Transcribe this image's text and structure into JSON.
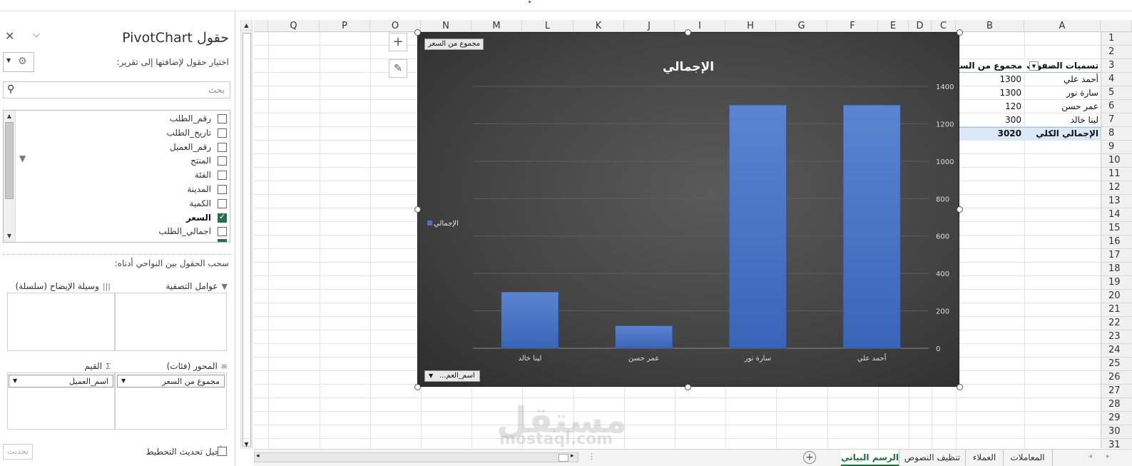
{
  "pane": {
    "title": "حقول PivotChart",
    "subtitle": "اختيار حقول لإضافتها إلى تقرير:",
    "search_placeholder": "بحث",
    "fields": [
      {
        "label": "رقم_الطلب",
        "checked": false
      },
      {
        "label": "تاريخ_الطلب",
        "checked": false
      },
      {
        "label": "رقم_العميل",
        "checked": false
      },
      {
        "label": "المنتج",
        "checked": false
      },
      {
        "label": "الفئة",
        "checked": false
      },
      {
        "label": "المدينة",
        "checked": false
      },
      {
        "label": "الكمية",
        "checked": false
      },
      {
        "label": "السعر",
        "checked": true
      },
      {
        "label": "اجمالي_الطلب",
        "checked": false
      }
    ],
    "drag_hint": "سحب الحقول بين النواحي أدناه:",
    "areas": {
      "filters": "عوامل التصفية",
      "legend": "وسيلة الإيضاح (سلسلة)",
      "axis": "المحور (فئات)",
      "values": "القيم",
      "axis_item": "اسم_العميل",
      "values_item": "مجموع من السعر"
    },
    "defer_label": "تأجيل تحديث التخطيط",
    "update_button": "تحديث"
  },
  "grid": {
    "columns": [
      "Q",
      "P",
      "O",
      "N",
      "M",
      "L",
      "K",
      "J",
      "I",
      "H",
      "G",
      "F",
      "E",
      "D",
      "C",
      "B",
      "A"
    ],
    "rows": [
      "1",
      "2",
      "3",
      "4",
      "5",
      "6",
      "7",
      "8",
      "9",
      "10",
      "11",
      "12",
      "13",
      "14",
      "15",
      "16",
      "17",
      "18",
      "19",
      "20",
      "21",
      "22",
      "23",
      "24",
      "25",
      "26",
      "27",
      "28",
      "29",
      "30",
      "31"
    ],
    "pivot": {
      "row_header": "تسميات الصفوف",
      "value_header": "مجموع من السعر",
      "items": [
        {
          "name": "أحمد علي",
          "value": "1300"
        },
        {
          "name": "سارة نور",
          "value": "1300"
        },
        {
          "name": "عمر حسن",
          "value": "120"
        },
        {
          "name": "لينا خالد",
          "value": "300"
        }
      ],
      "total_label": "الإجمالي الكلي",
      "total_value": "3020"
    }
  },
  "chart_data": {
    "type": "bar",
    "title": "الإجمالي",
    "categories": [
      "أحمد علي",
      "سارة نور",
      "عمر حسن",
      "لينا خالد"
    ],
    "series": [
      {
        "name": "الإجمالي",
        "values": [
          1300,
          1300,
          120,
          300
        ]
      }
    ],
    "ylim": [
      0,
      1400
    ],
    "yticks": [
      0,
      200,
      400,
      600,
      800,
      1000,
      1200,
      1400
    ],
    "legend": "left",
    "grid": true,
    "value_field_button": "مجموع من السعر",
    "axis_field_button": "اسم_العم...",
    "bar_color": "#4472c4"
  },
  "tabs": {
    "sheets": [
      "الرسم البياني",
      "تنظيف النصوص",
      "العملاء",
      "المعاملات"
    ],
    "active": 0
  },
  "watermark": {
    "main": "مستقل",
    "sub": "mostaql.com"
  }
}
